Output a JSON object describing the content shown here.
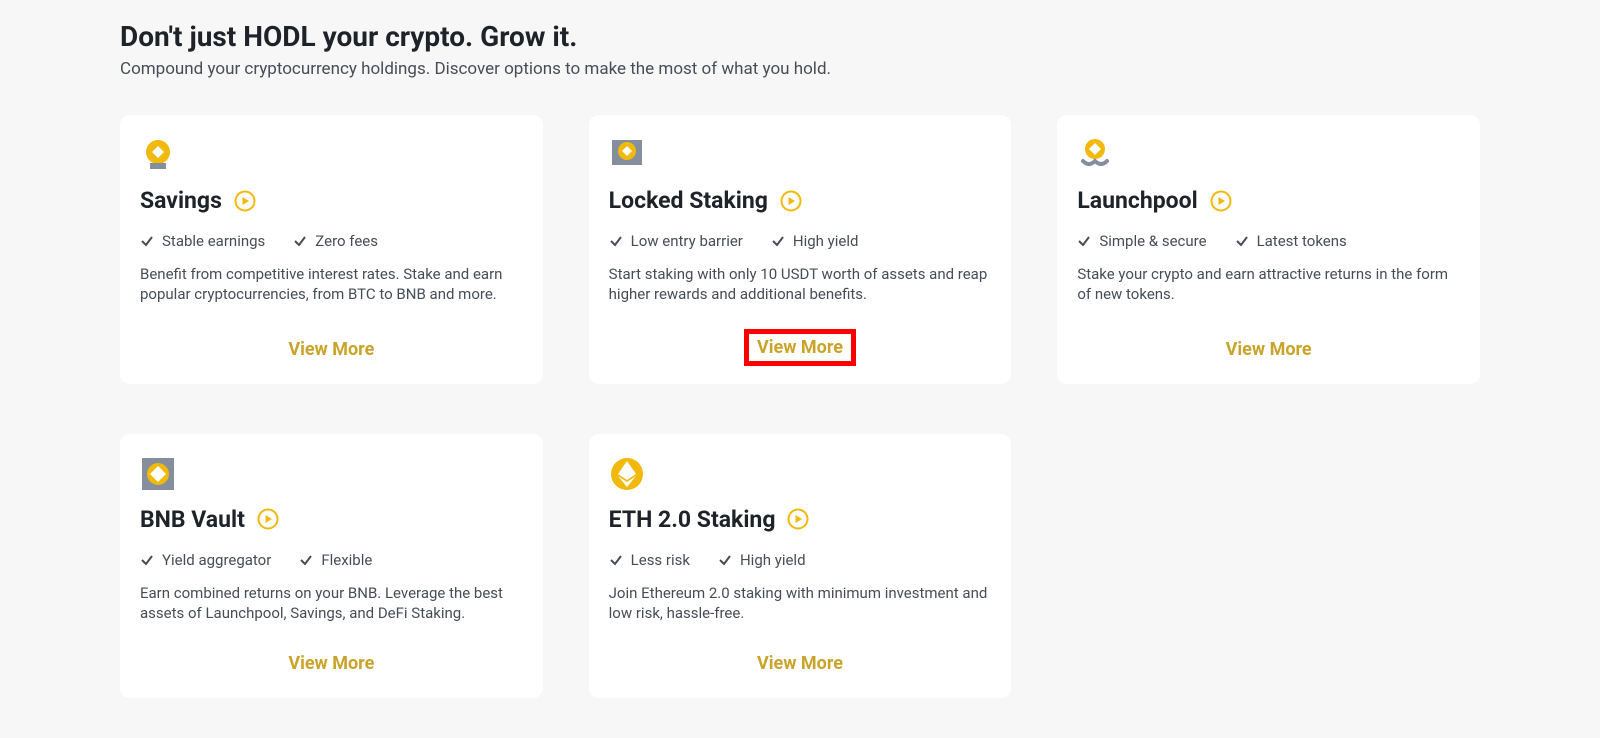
{
  "header": {
    "title": "Don't just HODL your crypto. Grow it.",
    "subtitle": "Compound your cryptocurrency holdings. Discover options to make the most of what you hold."
  },
  "cards": [
    {
      "icon": "savings-icon",
      "title": "Savings",
      "features": [
        "Stable earnings",
        "Zero fees"
      ],
      "description": "Benefit from competitive interest rates. Stake and earn popular cryptocurrencies, from BTC to BNB and more.",
      "cta": "View More",
      "highlight": false
    },
    {
      "icon": "locked-staking-icon",
      "title": "Locked Staking",
      "features": [
        "Low entry barrier",
        "High yield"
      ],
      "description": "Start staking with only 10 USDT worth of assets and reap higher rewards and additional benefits.",
      "cta": "View More",
      "highlight": true
    },
    {
      "icon": "launchpool-icon",
      "title": "Launchpool",
      "features": [
        "Simple & secure",
        "Latest tokens"
      ],
      "description": "Stake your crypto and earn attractive returns in the form of new tokens.",
      "cta": "View More",
      "highlight": false
    },
    {
      "icon": "bnb-vault-icon",
      "title": "BNB Vault",
      "features": [
        "Yield aggregator",
        "Flexible"
      ],
      "description": "Earn combined returns on your BNB. Leverage the best assets of Launchpool, Savings, and DeFi Staking.",
      "cta": "View More",
      "highlight": false
    },
    {
      "icon": "eth-staking-icon",
      "title": "ETH 2.0 Staking",
      "features": [
        "Less risk",
        "High yield"
      ],
      "description": "Join Ethereum 2.0 staking with minimum investment and low risk, hassle-free.",
      "cta": "View More",
      "highlight": false
    }
  ],
  "colors": {
    "accent": "#f0b90b",
    "accent_dark": "#caa42a",
    "gray": "#848e9c"
  }
}
